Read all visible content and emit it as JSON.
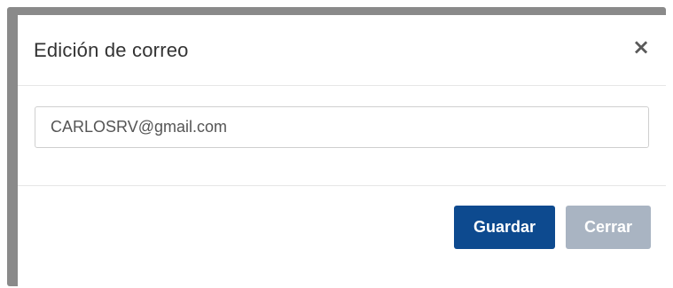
{
  "dialog": {
    "title": "Edición de correo",
    "close_symbol": "×",
    "close_icon": "close-icon"
  },
  "form": {
    "email_value": "CARLOSRV@gmail.com"
  },
  "footer": {
    "save_label": "Guardar",
    "close_label": "Cerrar"
  },
  "colors": {
    "primary": "#0d4a8f",
    "disabled": "#a9b4c2",
    "overlay": "#8a8a8a"
  }
}
